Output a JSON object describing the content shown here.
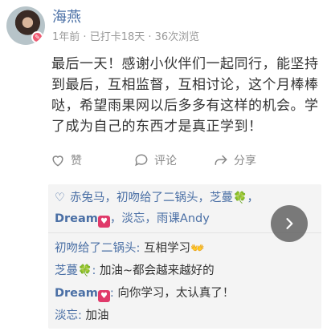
{
  "post": {
    "author": "海燕",
    "meta": [
      "1年前",
      "已打卡18天",
      "36次浏览"
    ],
    "content": "最后一天！感谢小伙伴们一起同行，能坚持到最后，互相监督，互相讨论，这个月棒棒哒，希望雨果网以后多多有这样的机会。学了成为自己的东西才是真正学到！"
  },
  "actions": {
    "like_label": "赞",
    "comment_label": "评论",
    "share_label": "分享"
  },
  "likes": {
    "names": [
      "赤兔马",
      "初吻给了二锅头",
      "芝蔓",
      "Dream",
      "淡忘",
      "雨课Andy"
    ]
  },
  "comments": [
    {
      "name": "初吻给了二锅头",
      "text": "互相学习"
    },
    {
      "name": "芝蔓",
      "text": "加油~都会越来越好的"
    },
    {
      "name": "Dream",
      "text": "向你学习，太认真了！"
    },
    {
      "name": "淡忘",
      "text": "加油"
    }
  ],
  "colors": {
    "link": "#4a6fa5",
    "panel_bg": "#f4f4f4",
    "meta_gray": "#9a9a9a"
  },
  "icons": {
    "like": "heart-outline-icon",
    "comment": "speech-bubble-icon",
    "share": "share-arrow-icon",
    "next": "chevron-right-icon"
  }
}
